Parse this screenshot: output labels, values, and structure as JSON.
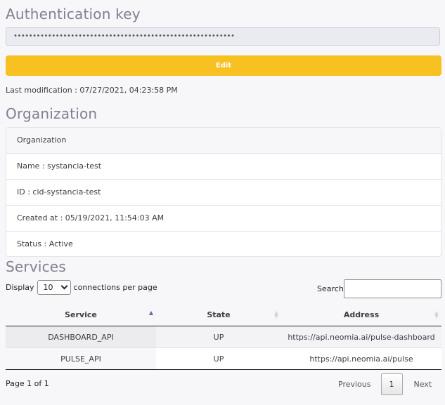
{
  "auth": {
    "title": "Authentication key",
    "masked_value": "••••••••••••••••••••••••••••••••••••••••••••••••••••••••••",
    "edit_label": "Edit",
    "last_modification": "Last modification : 07/27/2021, 04:23:58 PM",
    "button_color": "#f7c122"
  },
  "organization": {
    "title": "Organization",
    "rows": [
      "Organization",
      "Name : systancia-test",
      "ID : cid-systancia-test",
      "Created at : 05/19/2021, 11:54:03 AM",
      "Status : Active"
    ]
  },
  "services": {
    "title": "Services",
    "display_prefix": "Display",
    "display_value": "10",
    "display_suffix": "connections per page",
    "search_label": "Search",
    "search_value": "",
    "columns": [
      "Service",
      "State",
      "Address"
    ],
    "sorted_column": "Service",
    "sort_direction": "ascending",
    "rows": [
      {
        "service": "DASHBOARD_API",
        "state": "UP",
        "address": "https://api.neomia.ai/pulse-dashboard"
      },
      {
        "service": "PULSE_API",
        "state": "UP",
        "address": "https://api.neomia.ai/pulse"
      }
    ],
    "page_info": "Page 1 of 1",
    "pager": {
      "previous": "Previous",
      "current": "1",
      "next": "Next"
    }
  }
}
